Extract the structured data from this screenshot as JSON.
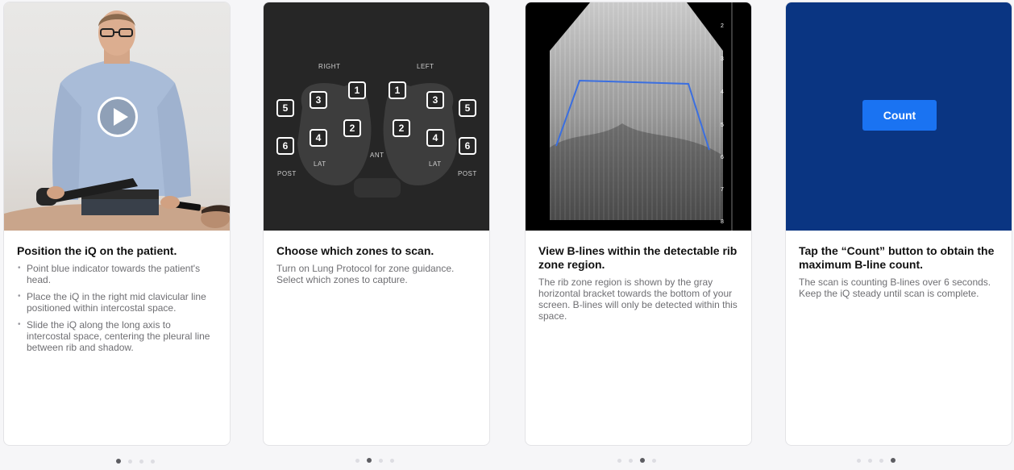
{
  "cards": [
    {
      "title": "Position the iQ on the patient.",
      "bullets": [
        "Point blue indicator towards the patient's head.",
        "Place the iQ in the right mid clavicular line positioned within intercostal space.",
        "Slide the iQ along the long axis to intercostal space, centering the pleural line between rib and shadow."
      ],
      "media": {
        "play_icon": "play-icon"
      }
    },
    {
      "title": "Choose which zones to scan.",
      "text": "Turn on Lung Protocol for zone guidance. Select which zones to capture.",
      "diagram": {
        "right": "RIGHT",
        "left": "LEFT",
        "ant": "ANT",
        "lat_left": "LAT",
        "lat_right": "LAT",
        "post_left": "POST",
        "post_right": "POST",
        "zones_right": [
          "1",
          "2",
          "3",
          "4",
          "5",
          "6"
        ],
        "zones_left": [
          "1",
          "2",
          "3",
          "4",
          "5",
          "6"
        ]
      }
    },
    {
      "title": "View B-lines within the detectable rib zone region.",
      "text": "The rib zone region is shown by the gray horizontal bracket towards the bottom of your screen. B-lines will only be detected within this space.",
      "depth_scale": [
        "2",
        "3",
        "4",
        "5",
        "6",
        "7",
        "8"
      ]
    },
    {
      "title": "Tap the “Count” button to obtain the maximum B-line count.",
      "text": "The scan is counting B-lines over 6 seconds. Keep the iQ steady until scan is complete.",
      "button_label": "Count"
    }
  ],
  "pagination": {
    "total": 4
  },
  "colors": {
    "count_button": "#1a73f2",
    "panel_blue": "#0a3582",
    "bracket_blue": "#3b6fe0"
  }
}
